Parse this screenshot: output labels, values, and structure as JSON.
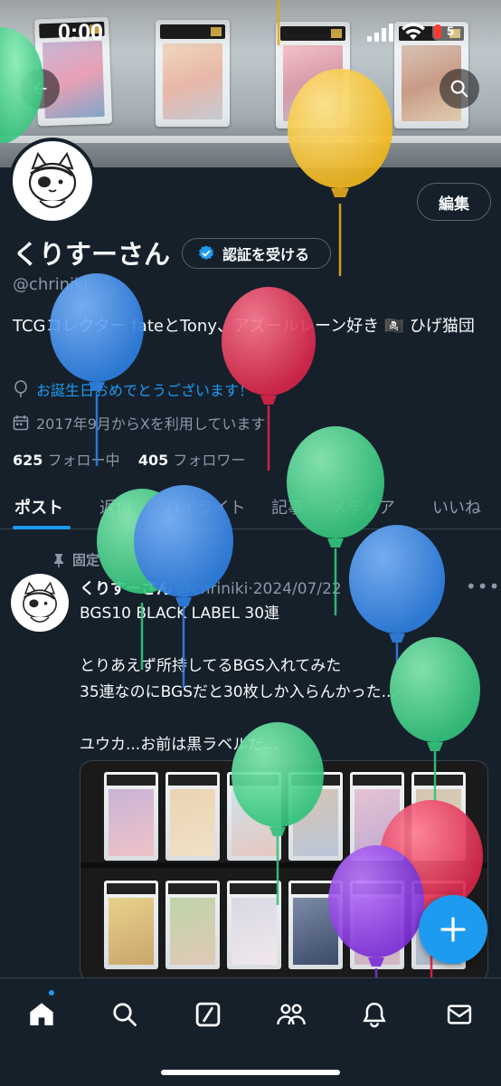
{
  "status_bar": {
    "time": "0:00",
    "battery": "5"
  },
  "profile": {
    "name": "くりすーさん",
    "handle": "@chriniki",
    "verify_label": "認証を受ける",
    "edit_label": "編集",
    "bio": "TCGコレクター fateとTony、アズールレーン好き 🏴‍☠️ ひげ猫団",
    "birthday": "お誕生日おめでとうございます！",
    "joined": "2017年9月からXを利用しています",
    "following_count": "625",
    "following_label": "フォロー中",
    "followers_count": "405",
    "followers_label": "フォロワー"
  },
  "tabs": [
    "ポスト",
    "返信",
    "ハイライト",
    "記事",
    "メディア",
    "いいね"
  ],
  "post": {
    "pinned_label": "固定",
    "author": "くりすーさん",
    "handle": "@chriniki",
    "date": "2024/07/22",
    "lines": [
      "BGS10 BLACK LABEL 30連",
      "",
      "とりあえず所持してるBGS入れてみた",
      "35連なのにBGSだと30枚しか入らんかった...",
      "",
      "ユウカ...お前は黒ラベルだ..."
    ]
  },
  "colors": {
    "accent": "#1d9bf0",
    "background": "#15202b"
  },
  "icons": {
    "back": "arrow-left-icon",
    "search": "search-icon",
    "verified": "verified-badge-icon",
    "birthday": "balloon-icon",
    "calendar": "calendar-icon",
    "pin": "pin-icon",
    "compose": "plus-icon",
    "nav": [
      "home-icon",
      "search-icon",
      "grok-icon",
      "communities-icon",
      "bell-icon",
      "mail-icon"
    ]
  }
}
